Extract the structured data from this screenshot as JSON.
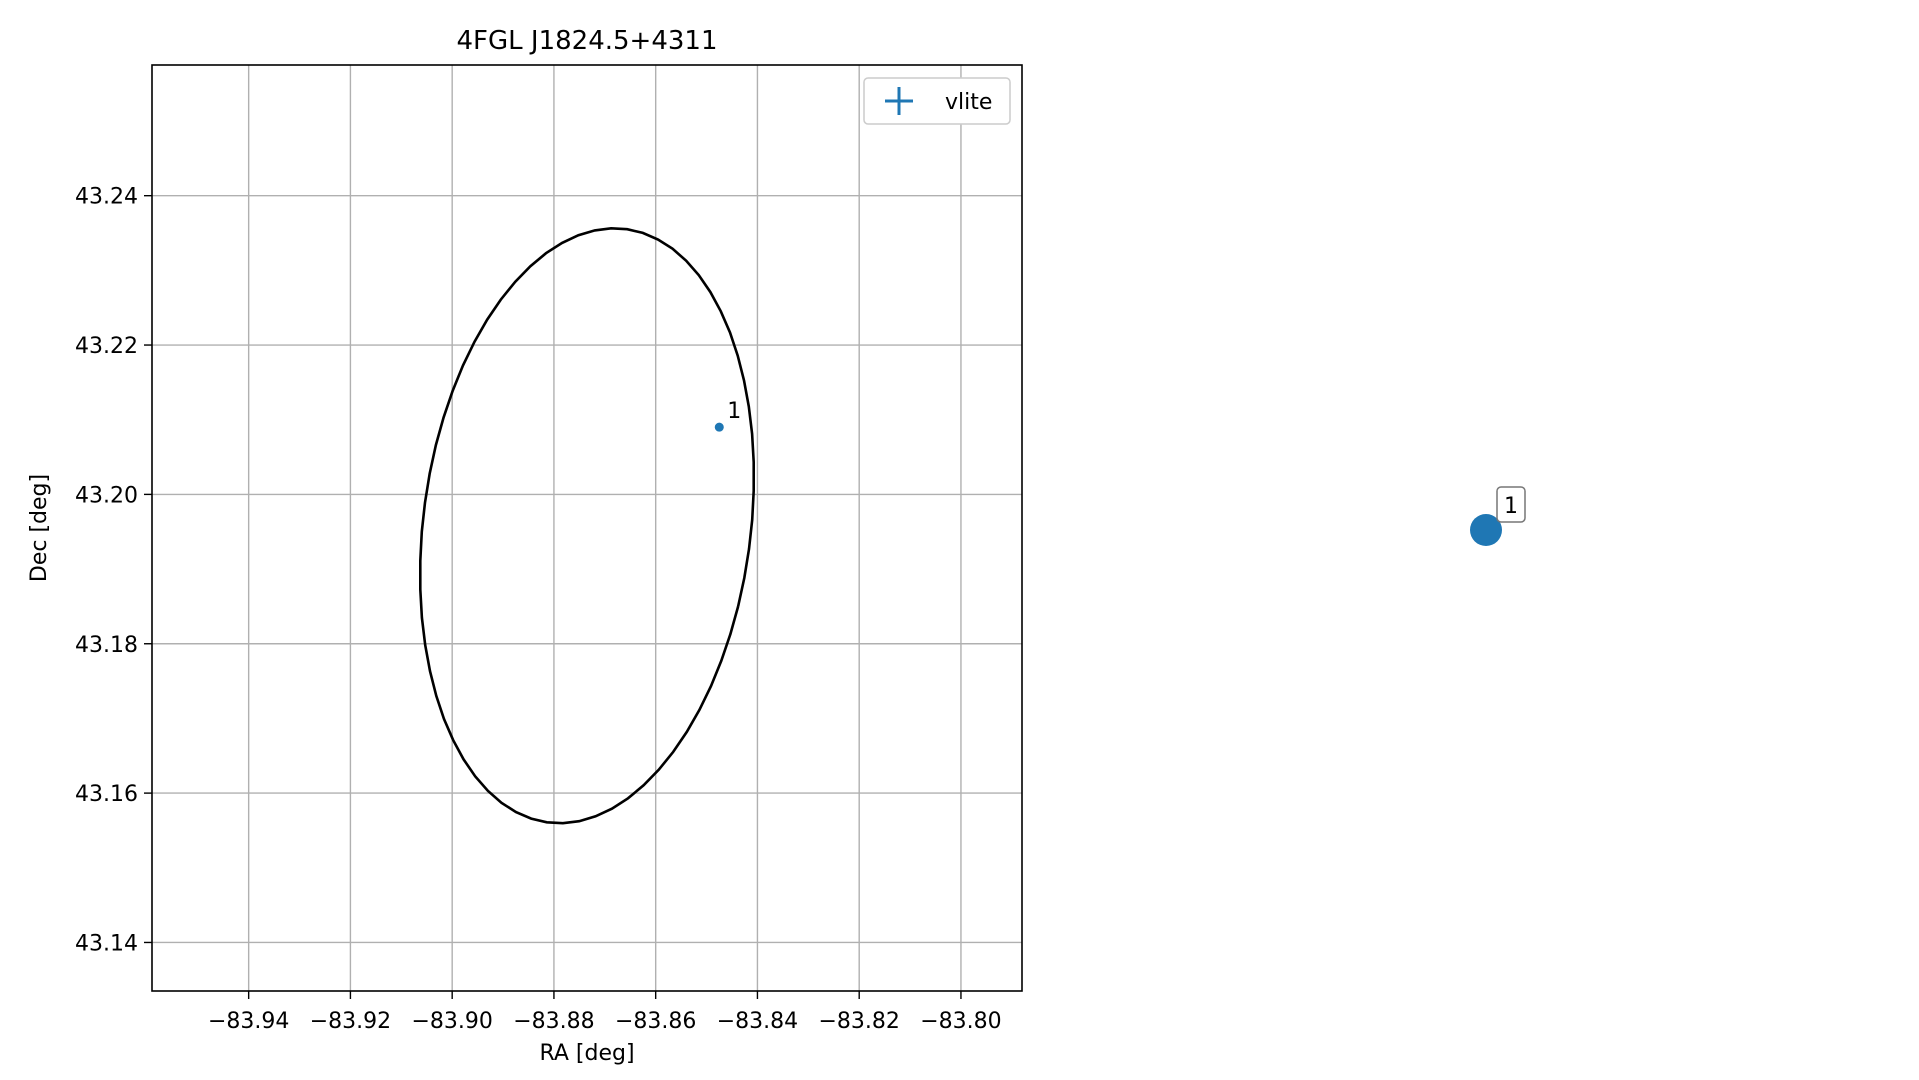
{
  "chart_data": [
    {
      "type": "scatter",
      "title": "4FGL J1824.5+4311",
      "xlabel": "RA [deg]",
      "ylabel": "Dec [deg]",
      "xlim": [
        -83.959,
        -83.788
      ],
      "ylim": [
        43.1335,
        43.2575
      ],
      "x_ticks": [
        -83.94,
        -83.92,
        -83.9,
        -83.88,
        -83.86,
        -83.84,
        -83.82,
        -83.8
      ],
      "x_tick_labels": [
        "−83.94",
        "−83.92",
        "−83.90",
        "−83.88",
        "−83.86",
        "−83.84",
        "−83.82",
        "−83.80"
      ],
      "y_ticks": [
        43.14,
        43.16,
        43.18,
        43.2,
        43.22,
        43.24
      ],
      "y_tick_labels": [
        "43.14",
        "43.16",
        "43.18",
        "43.20",
        "43.22",
        "43.24"
      ],
      "grid": true,
      "legend": {
        "position": "top-right",
        "entries": [
          {
            "label": "vlite",
            "color": "#1f77b4",
            "marker": "errorbar-cross"
          }
        ]
      },
      "series": [
        {
          "name": "vlite",
          "color": "#1f77b4",
          "points": [
            {
              "x": -83.8475,
              "y": 43.209,
              "label": "1"
            }
          ]
        }
      ],
      "ellipse": {
        "color": "#000000",
        "center": {
          "x": -83.8735,
          "y": 43.1958
        },
        "semi_major_deg": 0.0408,
        "semi_minor_deg": 0.0316,
        "position_angle_deg": 20
      }
    },
    {
      "type": "scatter",
      "axes_visible": false,
      "series": [
        {
          "color": "#1f77b4",
          "points": [
            {
              "x": 0,
              "y": 0,
              "label": "1"
            }
          ]
        }
      ]
    }
  ]
}
